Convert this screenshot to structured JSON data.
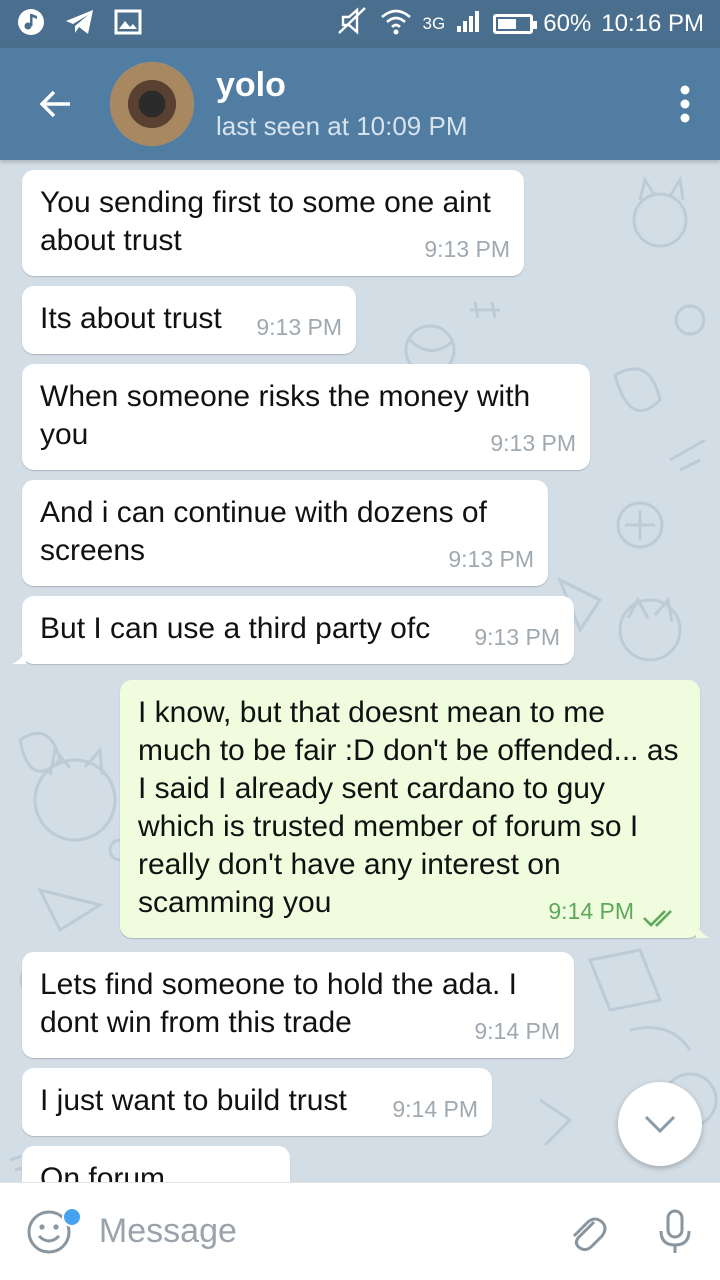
{
  "status_bar": {
    "network": "3G",
    "battery": "60%",
    "battery_level": 0.6,
    "time": "10:16 PM"
  },
  "header": {
    "name": "yolo",
    "status": "last seen at 10:09 PM"
  },
  "messages": [
    {
      "dir": "in",
      "text": "You sending first to some one aint about trust",
      "time": "9:13 PM"
    },
    {
      "dir": "in",
      "text": "Its about trust",
      "time": "9:13 PM"
    },
    {
      "dir": "in",
      "text": "When someone risks the money with you",
      "time": "9:13 PM"
    },
    {
      "dir": "in",
      "text": "And i can continue with dozens of screens",
      "time": "9:13 PM"
    },
    {
      "dir": "in",
      "text": "But I can use a third party ofc",
      "time": "9:13 PM"
    },
    {
      "dir": "out",
      "text": "I know, but that doesnt mean to me much to be fair :D don't be offended... as I said I already sent cardano to guy which is trusted member of forum so I really don't have any interest on scamming you",
      "time": "9:14 PM",
      "read": true
    },
    {
      "dir": "in",
      "text": "Lets find someone to hold the ada. I dont win from this trade",
      "time": "9:14 PM"
    },
    {
      "dir": "in",
      "text": "I just want to build trust",
      "time": "9:14 PM"
    },
    {
      "dir": "in",
      "text": "On forum",
      "time": ""
    }
  ],
  "input": {
    "placeholder": "Message"
  },
  "colors": {
    "header": "#517da2",
    "status_bar": "#4a6f8e",
    "outgoing_bubble": "#effdde",
    "incoming_bubble": "#ffffff",
    "read_check": "#5ea85a",
    "chat_background": "#d3dde5"
  }
}
